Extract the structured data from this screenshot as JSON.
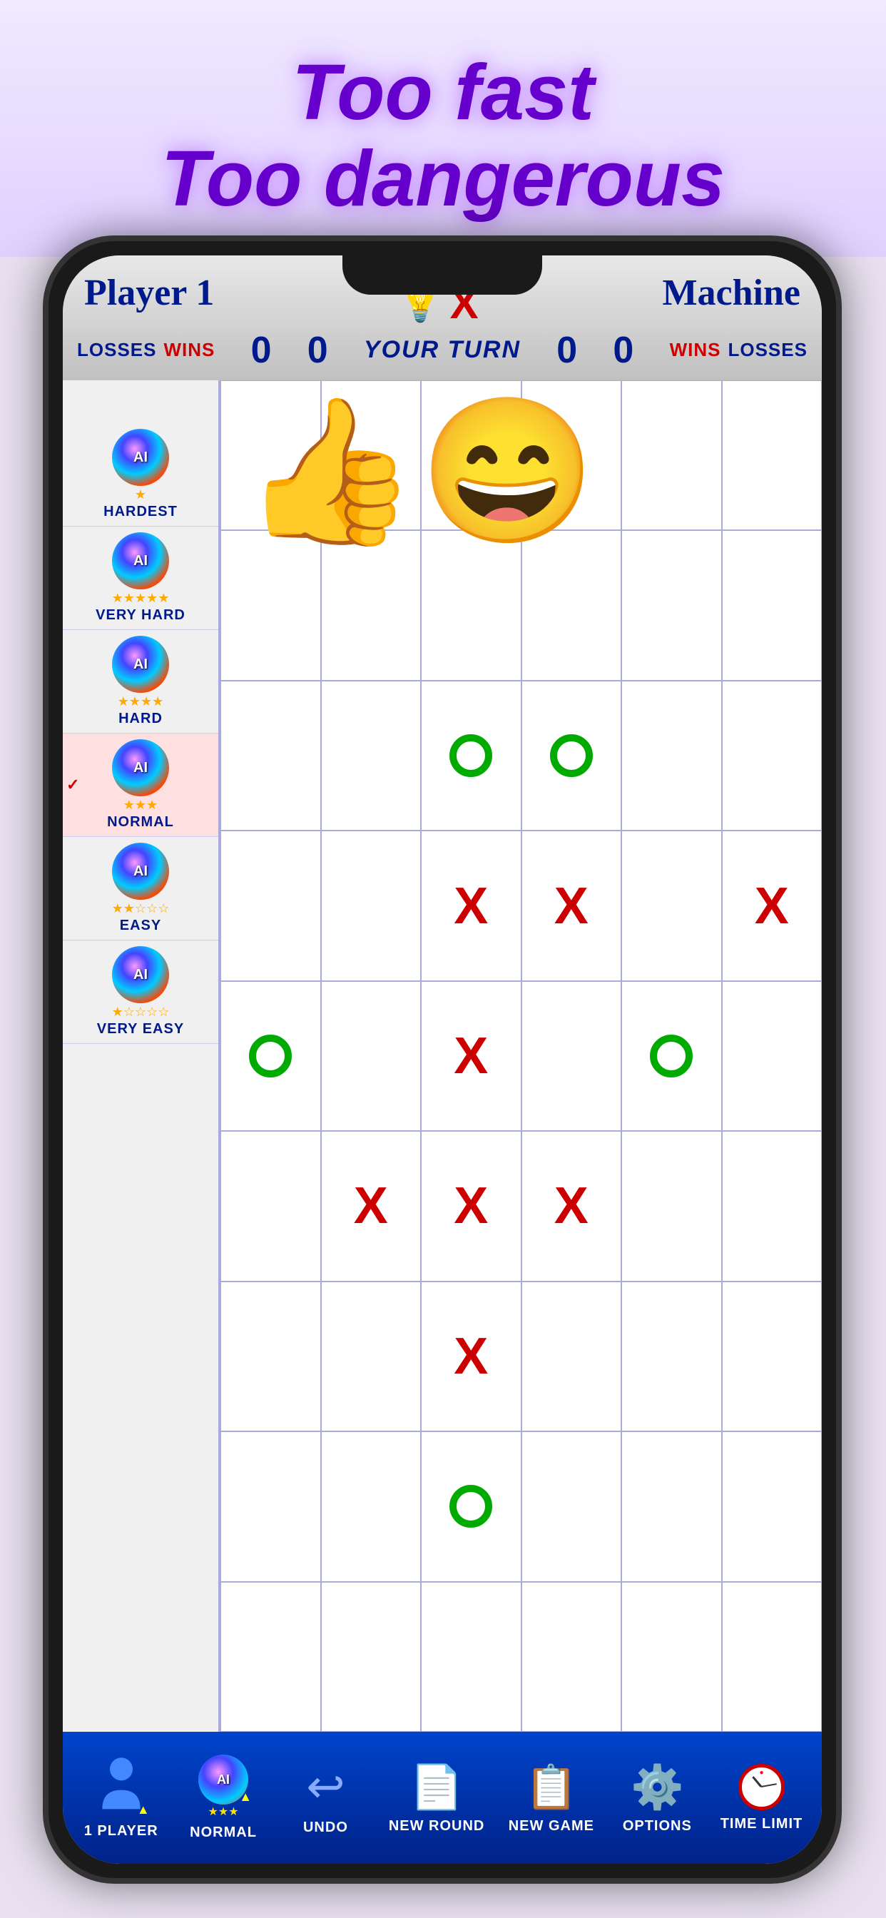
{
  "banner": {
    "line1": "Too fast",
    "line2": "Too dangerous"
  },
  "header": {
    "player_title": "Player 1",
    "machine_title": "Machine",
    "player_losses_label": "LOSSES",
    "player_wins_label": "WINS",
    "machine_wins_label": "WINS",
    "machine_losses_label": "LOSSES",
    "player_losses_value": "0",
    "player_wins_value": "0",
    "machine_wins_value": "0",
    "machine_losses_value": "0",
    "turn_label": "YOUR TURN"
  },
  "ai_options": [
    {
      "label": "AI",
      "stars": "★",
      "difficulty": "HARDEST",
      "selected": false
    },
    {
      "label": "AI",
      "stars": "★★★★★",
      "difficulty": "VERY HARD",
      "selected": false
    },
    {
      "label": "AI",
      "stars": "★★★★",
      "difficulty": "HARD",
      "selected": false
    },
    {
      "label": "AI",
      "stars": "★★★",
      "difficulty": "NORMAL",
      "selected": true
    },
    {
      "label": "AI",
      "stars": "★★☆☆☆",
      "difficulty": "EASY",
      "selected": false
    },
    {
      "label": "AI",
      "stars": "★☆☆☆☆",
      "difficulty": "VERY EASY",
      "selected": false
    }
  ],
  "grid": {
    "rows": 9,
    "cols": 6,
    "cells": [
      "",
      "",
      "",
      "",
      "",
      "",
      "",
      "",
      "",
      "",
      "",
      "",
      "",
      "",
      "O",
      "O",
      "",
      "",
      "",
      "",
      "X",
      "X",
      "",
      "X",
      "O",
      "",
      "X",
      "",
      "O",
      "",
      "",
      "X",
      "X",
      "X",
      "",
      "",
      "",
      "",
      "X",
      "",
      "",
      "",
      "",
      "",
      "O",
      "",
      "",
      "",
      "",
      "",
      "",
      "",
      "",
      ""
    ]
  },
  "toolbar": {
    "player_label": "1 PLAYER",
    "ai_label": "NORMAL",
    "undo_label": "UNDO",
    "new_round_label": "NEW ROUND",
    "new_game_label": "NEW GAME",
    "options_label": "OPTIONS",
    "time_limit_label": "TIME LIMIT"
  }
}
